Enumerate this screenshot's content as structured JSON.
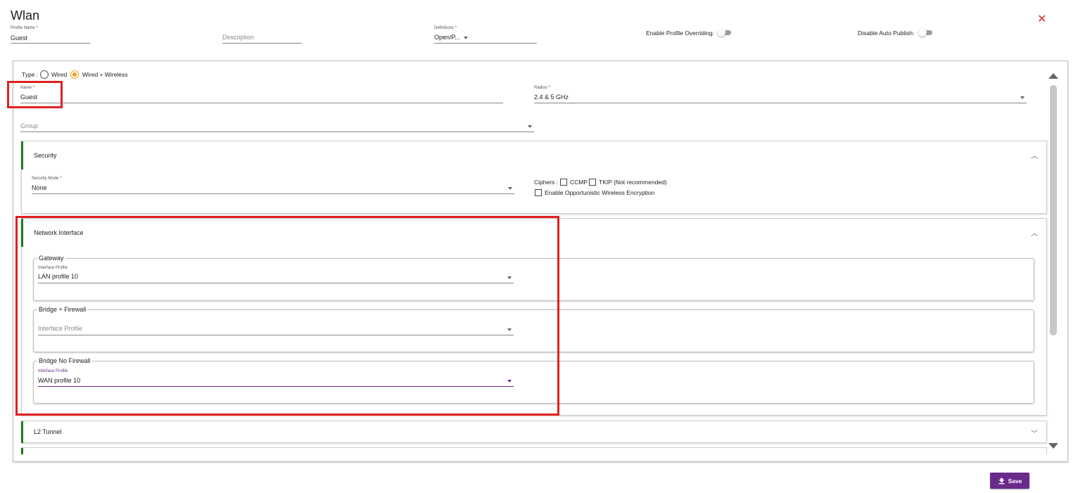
{
  "dialog": {
    "title": "Wlan",
    "close_glyph": "✕"
  },
  "header": {
    "profile_name": {
      "label": "Profile Name *",
      "value": "Guest"
    },
    "description": {
      "placeholder": "Description"
    },
    "definitions": {
      "label": "Definitions *",
      "value": "Open/P..."
    },
    "enable_profile_overriding": {
      "label": "Enable Profile Overriding:",
      "on": false
    },
    "disable_auto_publish": {
      "label": "Disable Auto Publish:",
      "on": false
    }
  },
  "form": {
    "type": {
      "label": "Type :",
      "options": [
        "Wired",
        "Wired + Wireless"
      ],
      "selected": "Wired + Wireless"
    },
    "name": {
      "label": "Name *",
      "value": "Guest"
    },
    "radios": {
      "label": "Radios *",
      "value": "2.4 & 5 GHz"
    },
    "group": {
      "placeholder": "Group"
    }
  },
  "security": {
    "title": "Security",
    "security_mode": {
      "label": "Security Mode *",
      "value": "None"
    },
    "ciphers_label": "Ciphers :",
    "ccmp": "CCMP",
    "tkip": "TKIP (Not recommended)",
    "owe": "Enable Opportunistic Wireless Encryption"
  },
  "network_interface": {
    "title": "Network Interface",
    "gateway": {
      "legend": "Gateway",
      "label": "Interface Profile",
      "value": "LAN profile 10"
    },
    "bridge_firewall": {
      "legend": "Bridge + Firewall",
      "placeholder": "Interface Profile"
    },
    "bridge_no_firewall": {
      "legend": "Bridge No Firewall",
      "label": "Interface Profile",
      "value": "WAN profile 10"
    }
  },
  "l2_tunnel": {
    "title": "L2 Tunnel"
  },
  "save_label": "Save",
  "colors": {
    "accent_green": "#1e7a1e",
    "save_purple": "#6a2a8a",
    "highlight_red": "#e02020",
    "radio_orange": "#f0a020"
  }
}
